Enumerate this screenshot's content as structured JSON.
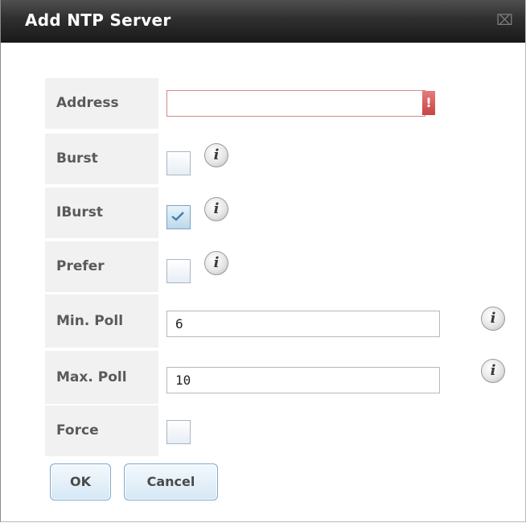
{
  "dialog": {
    "title": "Add NTP Server",
    "close_icon": "close-icon"
  },
  "fields": {
    "address": {
      "label": "Address",
      "value": "",
      "error_symbol": "!"
    },
    "burst": {
      "label": "Burst",
      "checked": false
    },
    "iburst": {
      "label": "IBurst",
      "checked": true
    },
    "prefer": {
      "label": "Prefer",
      "checked": false
    },
    "min_poll": {
      "label": "Min. Poll",
      "value": "6"
    },
    "max_poll": {
      "label": "Max. Poll",
      "value": "10"
    },
    "force": {
      "label": "Force",
      "checked": false
    }
  },
  "info_icon_glyph": "i",
  "buttons": {
    "ok": "OK",
    "cancel": "Cancel"
  },
  "colors": {
    "titlebar": "#2f2f2f",
    "error": "#c74444",
    "button_border": "#7fa6c9"
  }
}
